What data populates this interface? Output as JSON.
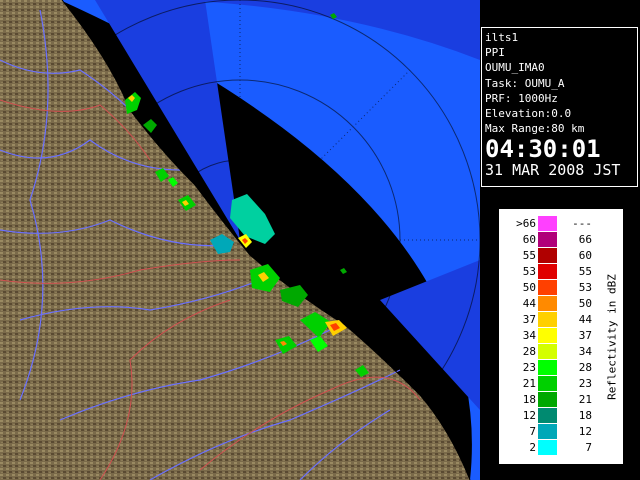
{
  "info": {
    "site": "ilts1",
    "scan_type": "PPI",
    "station": "OUMU_IMA0",
    "task": "Task: OUMU_A",
    "prf": "PRF: 1000Hz",
    "elevation": "Elevation:0.0",
    "max_range": "Max Range:80 km",
    "time": "04:30:01",
    "date": "31 MAR 2008 JST"
  },
  "legend": {
    "title": "Reflectivity in dBZ",
    "rows": [
      {
        "lo": ">66",
        "hi": "---",
        "color": "#ff40ff"
      },
      {
        "lo": "60",
        "hi": "66",
        "color": "#b0007a"
      },
      {
        "lo": "55",
        "hi": "60",
        "color": "#b00000"
      },
      {
        "lo": "53",
        "hi": "55",
        "color": "#e00000"
      },
      {
        "lo": "50",
        "hi": "53",
        "color": "#ff4000"
      },
      {
        "lo": "44",
        "hi": "50",
        "color": "#ff8a00"
      },
      {
        "lo": "37",
        "hi": "44",
        "color": "#ffd000"
      },
      {
        "lo": "34",
        "hi": "37",
        "color": "#ffff00"
      },
      {
        "lo": "28",
        "hi": "34",
        "color": "#d4ff00"
      },
      {
        "lo": "23",
        "hi": "28",
        "color": "#00ff00"
      },
      {
        "lo": "21",
        "hi": "23",
        "color": "#00d000"
      },
      {
        "lo": "18",
        "hi": "21",
        "color": "#00a800"
      },
      {
        "lo": "12",
        "hi": "18",
        "color": "#008a70"
      },
      {
        "lo": "7",
        "hi": "12",
        "color": "#00a8b8"
      },
      {
        "lo": "2",
        "hi": "7",
        "color": "#00ffff"
      }
    ]
  },
  "colors": {
    "sea": "#1a5cff",
    "sea_outer": "#1a3ee0",
    "land": "#7a6a4a",
    "range_ring": "#000000",
    "rivers": "#6a70ff",
    "borders": "#d05050"
  },
  "map": {
    "icon": "radar-ppi-map"
  }
}
